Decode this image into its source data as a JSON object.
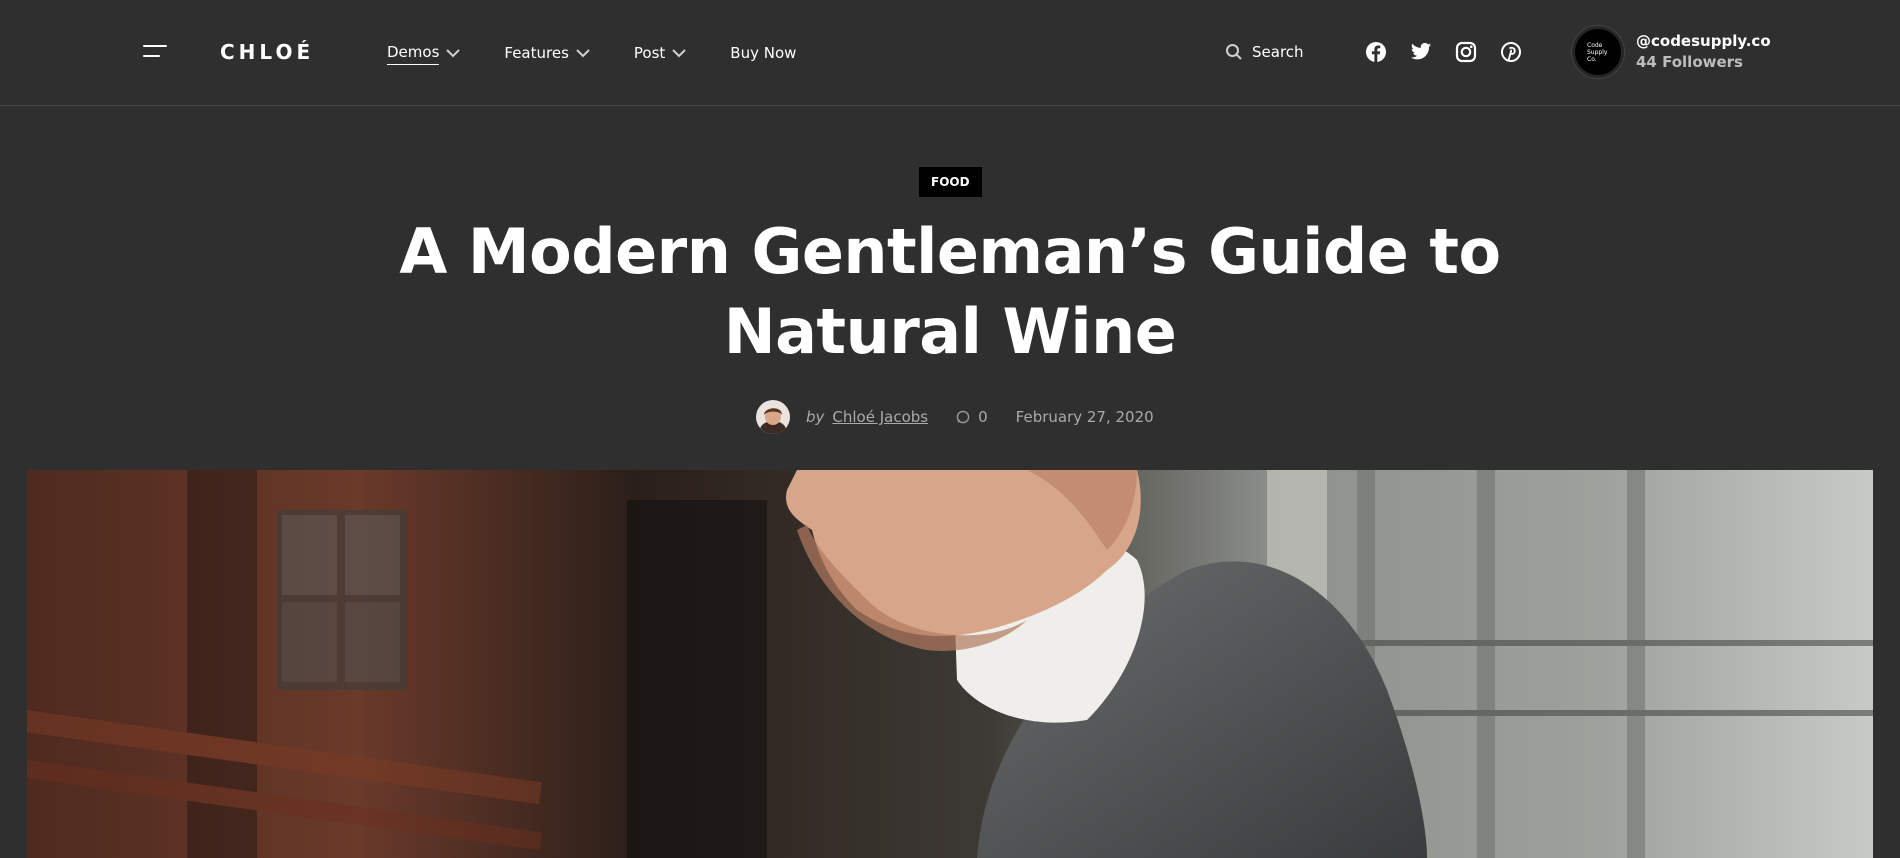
{
  "header": {
    "menu_icon": "hamburger-menu-icon",
    "logo": "CHLOÉ",
    "nav": [
      {
        "label": "Demos",
        "has_dropdown": true,
        "active": true
      },
      {
        "label": "Features",
        "has_dropdown": true
      },
      {
        "label": "Post",
        "has_dropdown": true
      },
      {
        "label": "Buy Now",
        "has_dropdown": false
      }
    ],
    "search_label": "Search",
    "social_icons": [
      "facebook-icon",
      "twitter-icon",
      "instagram-icon",
      "pinterest-icon"
    ],
    "account": {
      "avatar_text": "Code Supply Co.",
      "handle": "@codesupply.co",
      "followers": "44 Followers"
    }
  },
  "article": {
    "category": "FOOD",
    "title": "A Modern Gentleman’s Guide to Natural Wine",
    "by": "by",
    "author": "Chloé Jacobs",
    "comments": "0",
    "date": "February 27, 2020"
  },
  "colors": {
    "background": "#2f2f2f",
    "text": "#ffffff",
    "muted": "#aaaaaa",
    "badge": "#000000"
  }
}
